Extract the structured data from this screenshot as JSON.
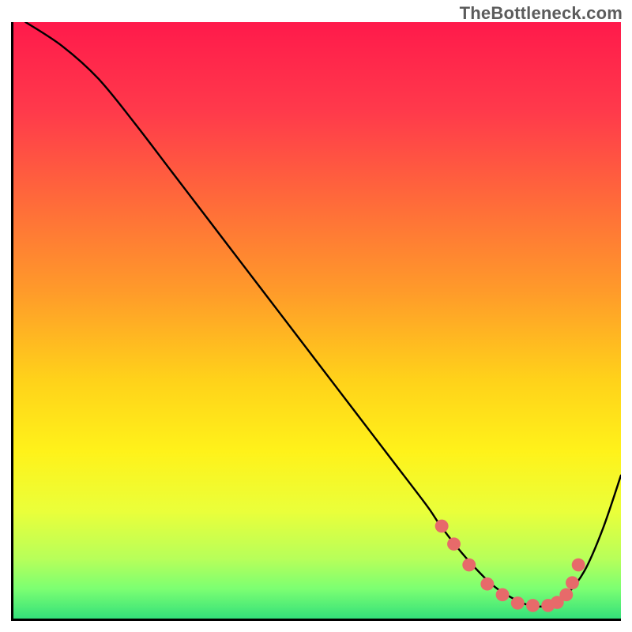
{
  "watermark": "TheBottleneck.com",
  "chart_data": {
    "type": "line",
    "title": "",
    "xlabel": "",
    "ylabel": "",
    "xlim": [
      0,
      100
    ],
    "ylim": [
      0,
      100
    ],
    "grid": false,
    "series": [
      {
        "name": "curve",
        "x": [
          2,
          8,
          14,
          20,
          26,
          32,
          38,
          44,
          50,
          56,
          62,
          68,
          70,
          73,
          76,
          79,
          82,
          85,
          88,
          91,
          94,
          97,
          100
        ],
        "y": [
          100,
          96,
          90.5,
          83,
          75,
          67,
          59,
          51,
          43,
          35,
          27,
          19,
          16,
          12,
          8.5,
          5.5,
          3.5,
          2.2,
          2.2,
          4,
          8,
          15,
          24
        ]
      }
    ],
    "dot_series": {
      "name": "dots",
      "x": [
        70.5,
        72.5,
        75,
        78,
        80.5,
        83,
        85.5,
        88,
        89.5,
        91,
        92,
        93
      ],
      "y": [
        15.5,
        12.5,
        9,
        5.8,
        4,
        2.6,
        2.2,
        2.2,
        2.7,
        4,
        6,
        9
      ]
    },
    "gradient_stops": [
      {
        "offset": 0.0,
        "color": "#ff1a4b"
      },
      {
        "offset": 0.15,
        "color": "#ff3a4b"
      },
      {
        "offset": 0.3,
        "color": "#ff6a3a"
      },
      {
        "offset": 0.45,
        "color": "#ff9a2a"
      },
      {
        "offset": 0.6,
        "color": "#ffd21a"
      },
      {
        "offset": 0.72,
        "color": "#fff21a"
      },
      {
        "offset": 0.82,
        "color": "#eaff3a"
      },
      {
        "offset": 0.9,
        "color": "#b7ff5a"
      },
      {
        "offset": 0.95,
        "color": "#7cff72"
      },
      {
        "offset": 1.0,
        "color": "#34e07a"
      }
    ],
    "dot_color": "#e76a6a",
    "dot_radius": 11
  }
}
